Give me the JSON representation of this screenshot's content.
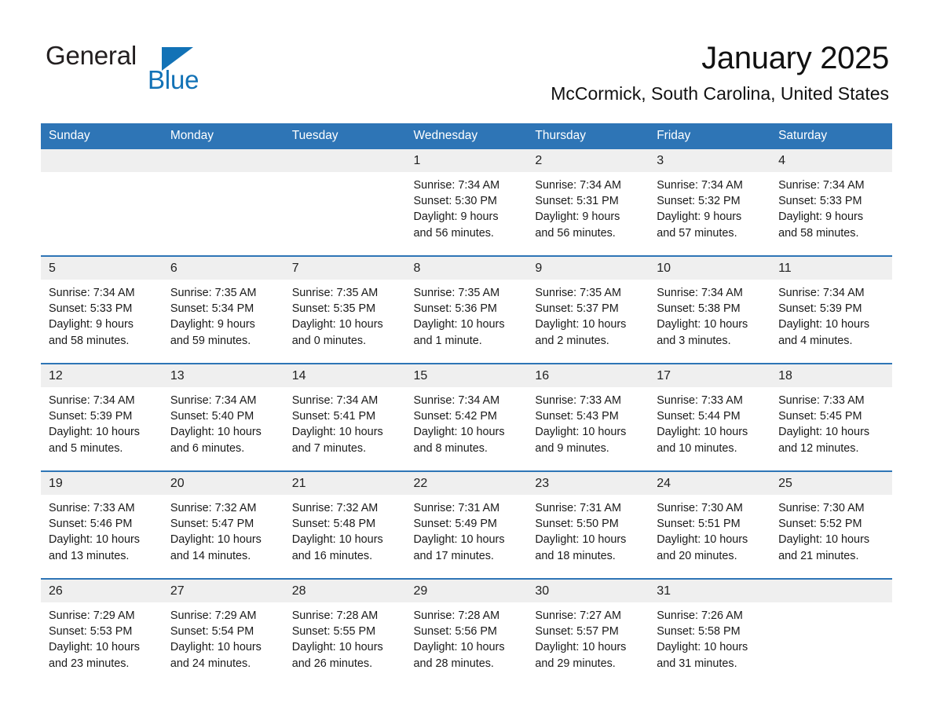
{
  "brand": {
    "name_part1": "General",
    "name_part2": "Blue",
    "triangle_color": "#1272b6",
    "text_color": "#231f20"
  },
  "header": {
    "month_title": "January 2025",
    "location": "McCormick, South Carolina, United States"
  },
  "theme": {
    "header_blue": "#2e75b6",
    "daynum_band": "#efefef",
    "text": "#1a1a1a",
    "page_background": "#ffffff"
  },
  "calendar": {
    "weekday_headers": [
      "Sunday",
      "Monday",
      "Tuesday",
      "Wednesday",
      "Thursday",
      "Friday",
      "Saturday"
    ],
    "weeks": [
      [
        {
          "day": "",
          "empty": true
        },
        {
          "day": "",
          "empty": true
        },
        {
          "day": "",
          "empty": true
        },
        {
          "day": "1",
          "sunrise": "Sunrise: 7:34 AM",
          "sunset": "Sunset: 5:30 PM",
          "daylight_line1": "Daylight: 9 hours",
          "daylight_line2": "and 56 minutes."
        },
        {
          "day": "2",
          "sunrise": "Sunrise: 7:34 AM",
          "sunset": "Sunset: 5:31 PM",
          "daylight_line1": "Daylight: 9 hours",
          "daylight_line2": "and 56 minutes."
        },
        {
          "day": "3",
          "sunrise": "Sunrise: 7:34 AM",
          "sunset": "Sunset: 5:32 PM",
          "daylight_line1": "Daylight: 9 hours",
          "daylight_line2": "and 57 minutes."
        },
        {
          "day": "4",
          "sunrise": "Sunrise: 7:34 AM",
          "sunset": "Sunset: 5:33 PM",
          "daylight_line1": "Daylight: 9 hours",
          "daylight_line2": "and 58 minutes."
        }
      ],
      [
        {
          "day": "5",
          "sunrise": "Sunrise: 7:34 AM",
          "sunset": "Sunset: 5:33 PM",
          "daylight_line1": "Daylight: 9 hours",
          "daylight_line2": "and 58 minutes."
        },
        {
          "day": "6",
          "sunrise": "Sunrise: 7:35 AM",
          "sunset": "Sunset: 5:34 PM",
          "daylight_line1": "Daylight: 9 hours",
          "daylight_line2": "and 59 minutes."
        },
        {
          "day": "7",
          "sunrise": "Sunrise: 7:35 AM",
          "sunset": "Sunset: 5:35 PM",
          "daylight_line1": "Daylight: 10 hours",
          "daylight_line2": "and 0 minutes."
        },
        {
          "day": "8",
          "sunrise": "Sunrise: 7:35 AM",
          "sunset": "Sunset: 5:36 PM",
          "daylight_line1": "Daylight: 10 hours",
          "daylight_line2": "and 1 minute."
        },
        {
          "day": "9",
          "sunrise": "Sunrise: 7:35 AM",
          "sunset": "Sunset: 5:37 PM",
          "daylight_line1": "Daylight: 10 hours",
          "daylight_line2": "and 2 minutes."
        },
        {
          "day": "10",
          "sunrise": "Sunrise: 7:34 AM",
          "sunset": "Sunset: 5:38 PM",
          "daylight_line1": "Daylight: 10 hours",
          "daylight_line2": "and 3 minutes."
        },
        {
          "day": "11",
          "sunrise": "Sunrise: 7:34 AM",
          "sunset": "Sunset: 5:39 PM",
          "daylight_line1": "Daylight: 10 hours",
          "daylight_line2": "and 4 minutes."
        }
      ],
      [
        {
          "day": "12",
          "sunrise": "Sunrise: 7:34 AM",
          "sunset": "Sunset: 5:39 PM",
          "daylight_line1": "Daylight: 10 hours",
          "daylight_line2": "and 5 minutes."
        },
        {
          "day": "13",
          "sunrise": "Sunrise: 7:34 AM",
          "sunset": "Sunset: 5:40 PM",
          "daylight_line1": "Daylight: 10 hours",
          "daylight_line2": "and 6 minutes."
        },
        {
          "day": "14",
          "sunrise": "Sunrise: 7:34 AM",
          "sunset": "Sunset: 5:41 PM",
          "daylight_line1": "Daylight: 10 hours",
          "daylight_line2": "and 7 minutes."
        },
        {
          "day": "15",
          "sunrise": "Sunrise: 7:34 AM",
          "sunset": "Sunset: 5:42 PM",
          "daylight_line1": "Daylight: 10 hours",
          "daylight_line2": "and 8 minutes."
        },
        {
          "day": "16",
          "sunrise": "Sunrise: 7:33 AM",
          "sunset": "Sunset: 5:43 PM",
          "daylight_line1": "Daylight: 10 hours",
          "daylight_line2": "and 9 minutes."
        },
        {
          "day": "17",
          "sunrise": "Sunrise: 7:33 AM",
          "sunset": "Sunset: 5:44 PM",
          "daylight_line1": "Daylight: 10 hours",
          "daylight_line2": "and 10 minutes."
        },
        {
          "day": "18",
          "sunrise": "Sunrise: 7:33 AM",
          "sunset": "Sunset: 5:45 PM",
          "daylight_line1": "Daylight: 10 hours",
          "daylight_line2": "and 12 minutes."
        }
      ],
      [
        {
          "day": "19",
          "sunrise": "Sunrise: 7:33 AM",
          "sunset": "Sunset: 5:46 PM",
          "daylight_line1": "Daylight: 10 hours",
          "daylight_line2": "and 13 minutes."
        },
        {
          "day": "20",
          "sunrise": "Sunrise: 7:32 AM",
          "sunset": "Sunset: 5:47 PM",
          "daylight_line1": "Daylight: 10 hours",
          "daylight_line2": "and 14 minutes."
        },
        {
          "day": "21",
          "sunrise": "Sunrise: 7:32 AM",
          "sunset": "Sunset: 5:48 PM",
          "daylight_line1": "Daylight: 10 hours",
          "daylight_line2": "and 16 minutes."
        },
        {
          "day": "22",
          "sunrise": "Sunrise: 7:31 AM",
          "sunset": "Sunset: 5:49 PM",
          "daylight_line1": "Daylight: 10 hours",
          "daylight_line2": "and 17 minutes."
        },
        {
          "day": "23",
          "sunrise": "Sunrise: 7:31 AM",
          "sunset": "Sunset: 5:50 PM",
          "daylight_line1": "Daylight: 10 hours",
          "daylight_line2": "and 18 minutes."
        },
        {
          "day": "24",
          "sunrise": "Sunrise: 7:30 AM",
          "sunset": "Sunset: 5:51 PM",
          "daylight_line1": "Daylight: 10 hours",
          "daylight_line2": "and 20 minutes."
        },
        {
          "day": "25",
          "sunrise": "Sunrise: 7:30 AM",
          "sunset": "Sunset: 5:52 PM",
          "daylight_line1": "Daylight: 10 hours",
          "daylight_line2": "and 21 minutes."
        }
      ],
      [
        {
          "day": "26",
          "sunrise": "Sunrise: 7:29 AM",
          "sunset": "Sunset: 5:53 PM",
          "daylight_line1": "Daylight: 10 hours",
          "daylight_line2": "and 23 minutes."
        },
        {
          "day": "27",
          "sunrise": "Sunrise: 7:29 AM",
          "sunset": "Sunset: 5:54 PM",
          "daylight_line1": "Daylight: 10 hours",
          "daylight_line2": "and 24 minutes."
        },
        {
          "day": "28",
          "sunrise": "Sunrise: 7:28 AM",
          "sunset": "Sunset: 5:55 PM",
          "daylight_line1": "Daylight: 10 hours",
          "daylight_line2": "and 26 minutes."
        },
        {
          "day": "29",
          "sunrise": "Sunrise: 7:28 AM",
          "sunset": "Sunset: 5:56 PM",
          "daylight_line1": "Daylight: 10 hours",
          "daylight_line2": "and 28 minutes."
        },
        {
          "day": "30",
          "sunrise": "Sunrise: 7:27 AM",
          "sunset": "Sunset: 5:57 PM",
          "daylight_line1": "Daylight: 10 hours",
          "daylight_line2": "and 29 minutes."
        },
        {
          "day": "31",
          "sunrise": "Sunrise: 7:26 AM",
          "sunset": "Sunset: 5:58 PM",
          "daylight_line1": "Daylight: 10 hours",
          "daylight_line2": "and 31 minutes."
        },
        {
          "day": "",
          "empty": true
        }
      ]
    ]
  }
}
